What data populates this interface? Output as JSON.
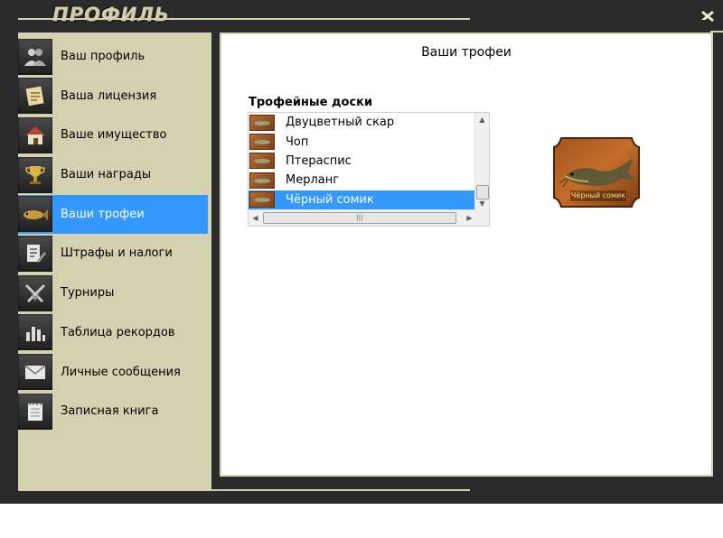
{
  "window": {
    "title": "ПРОФИЛЬ",
    "close_label": "X"
  },
  "sidebar": {
    "items": [
      {
        "label": "Ваш профиль",
        "icon": "users-icon"
      },
      {
        "label": "Ваша лицензия",
        "icon": "license-icon"
      },
      {
        "label": "Ваше имущество",
        "icon": "house-icon"
      },
      {
        "label": "Ваши награды",
        "icon": "cup-icon"
      },
      {
        "label": "Ваши трофеи",
        "icon": "fish-icon",
        "active": true
      },
      {
        "label": "Штрафы и налоги",
        "icon": "document-edit-icon"
      },
      {
        "label": "Турниры",
        "icon": "swords-icon"
      },
      {
        "label": "Таблица рекордов",
        "icon": "bar-chart-icon"
      },
      {
        "label": "Личные сообщения",
        "icon": "envelope-icon"
      },
      {
        "label": "Записная книга",
        "icon": "notebook-icon"
      }
    ]
  },
  "main": {
    "title": "Ваши трофеи",
    "boards_title": "Трофейные доски",
    "trophies": [
      {
        "name": "Двуцветный скар"
      },
      {
        "name": "Чоп"
      },
      {
        "name": "Птераспис"
      },
      {
        "name": "Мерланг"
      },
      {
        "name": "Чёрный сомик",
        "selected": true
      }
    ],
    "preview_label": "Чёрный сомик"
  },
  "colors": {
    "accent": "#3399ff",
    "frame": "#d3d1b0",
    "window_bg": "#2b2b2b"
  }
}
